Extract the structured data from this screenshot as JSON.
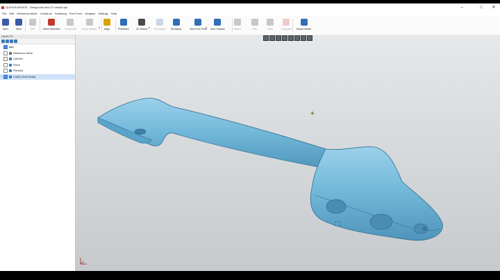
{
  "window": {
    "title": "QUICKSURFACE - DesignLink mini-07 rebuild.qsf",
    "minimize_glyph": "–",
    "maximize_glyph": "□",
    "close_glyph": "✕"
  },
  "menu": [
    "File",
    "Edit",
    "Reference Mesh",
    "Construct",
    "Surfacing",
    "Free Form",
    "Analysis",
    "Settings",
    "Help"
  ],
  "toolbar": [
    {
      "label": "Open",
      "icon": "open-folder-icon",
      "color": "#3d5aa8",
      "enabled": true
    },
    {
      "label": "Save",
      "icon": "save-icon",
      "color": "#3d5aa8",
      "enabled": true
    },
    {
      "label": "Edit",
      "icon": "edit-icon",
      "color": "#888888",
      "enabled": false
    },
    {
      "label": "Mesh Selection",
      "icon": "mesh-selection-icon",
      "color": "#c0392b",
      "enabled": true
    },
    {
      "label": "Control All",
      "icon": "control-all-icon",
      "color": "#888888",
      "enabled": false
    },
    {
      "label": "Show Hidden",
      "icon": "show-hidden-icon",
      "color": "#888888",
      "enabled": false
    },
    {
      "label": "Align",
      "icon": "align-icon",
      "color": "#d9a400",
      "enabled": true
    },
    {
      "label": "Primitives",
      "icon": "primitives-icon",
      "color": "#2f6fb5",
      "enabled": true
    },
    {
      "label": "2D Sketch",
      "icon": "sketch-2d-icon",
      "color": "#4a4a4a",
      "enabled": true
    },
    {
      "label": "Fit surface",
      "icon": "fit-surface-icon",
      "color": "#8aa9c9",
      "enabled": false
    },
    {
      "label": "Surfacing",
      "icon": "surfacing-icon",
      "color": "#2f6fb5",
      "enabled": true
    },
    {
      "label": "New Free Form",
      "icon": "new-free-form-icon",
      "color": "#2f6fb5",
      "enabled": true
    },
    {
      "label": "Auto Surface",
      "icon": "auto-surface-icon",
      "color": "#2f6fb5",
      "enabled": true
    },
    {
      "label": "Pattern",
      "icon": "pattern-icon",
      "color": "#888888",
      "enabled": false
    },
    {
      "label": "Trim",
      "icon": "trim-icon",
      "color": "#888888",
      "enabled": false
    },
    {
      "label": "Fillet",
      "icon": "fillet-icon",
      "color": "#888888",
      "enabled": false
    },
    {
      "label": "Compare",
      "icon": "compare-icon",
      "color": "#e08a8a",
      "enabled": false
    },
    {
      "label": "Export Model",
      "icon": "export-model-icon",
      "color": "#2f6fb5",
      "enabled": true
    }
  ],
  "objects_panel": {
    "title": "OBJECTS",
    "items": [
      {
        "label": "ALL",
        "checked": true,
        "expandable": false,
        "color": "#4a8ee0",
        "selected": false,
        "bold": true
      },
      {
        "label": "Reference Mesh",
        "checked": false,
        "expandable": true,
        "color": "#6a6a6a",
        "selected": false,
        "bold": false
      },
      {
        "label": "Cylinder",
        "checked": false,
        "expandable": false,
        "color": "#3a78b8",
        "selected": false,
        "bold": false
      },
      {
        "label": "Plane",
        "checked": false,
        "expandable": false,
        "color": "#3a78b8",
        "selected": false,
        "bold": false
      },
      {
        "label": "Plane(1)",
        "checked": false,
        "expandable": false,
        "color": "#3a78b8",
        "selected": false,
        "bold": false
      },
      {
        "label": "Cut(5) (Solid Body)",
        "checked": true,
        "expandable": true,
        "color": "#3a78b8",
        "selected": true,
        "bold": false
      }
    ]
  },
  "viewport": {
    "model_color": "#6fb6d8",
    "background": "#d6d9db"
  }
}
